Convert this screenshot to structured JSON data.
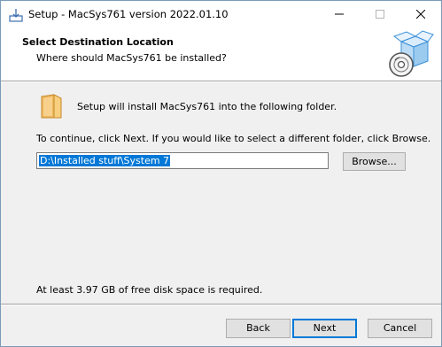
{
  "window": {
    "title": "Setup - MacSys761 version 2022.01.10"
  },
  "titlebar_buttons": {
    "minimize": "minimize-icon",
    "maximize": "maximize-icon",
    "close": "close-icon"
  },
  "header": {
    "title": "Select Destination Location",
    "subtitle": "Where should MacSys761 be installed?",
    "image": "setup-box-disc-icon"
  },
  "main": {
    "intro_text": "Setup will install MacSys761 into the following folder.",
    "instructions": "To continue, click Next. If you would like to select a different folder, click Browse.",
    "path_value": "D:\\Installed stuff\\System 7",
    "browse_label": "Browse...",
    "space_required": "At least 3.97 GB of free disk space is required."
  },
  "footer": {
    "back_label": "Back",
    "next_label": "Next",
    "cancel_label": "Cancel"
  },
  "colors": {
    "accent": "#0078d7",
    "selection": "#0078d7",
    "window_bg": "#f0f0f0",
    "header_bg": "#ffffff"
  }
}
